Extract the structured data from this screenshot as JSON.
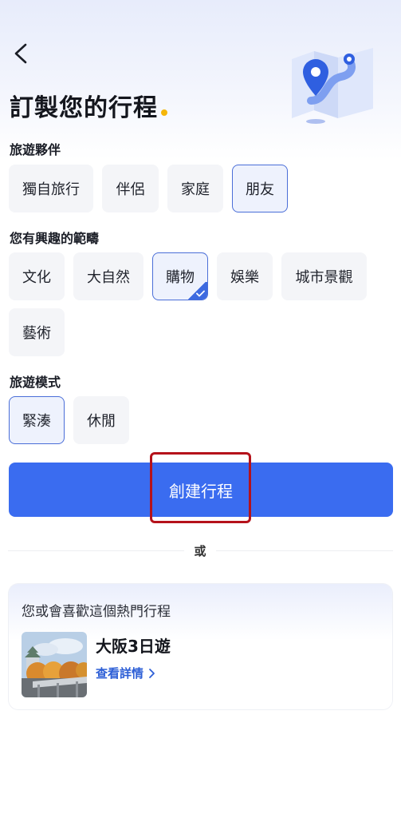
{
  "header": {
    "title": "訂製您的行程"
  },
  "companions": {
    "label": "旅遊夥伴",
    "options": [
      "獨自旅行",
      "伴侶",
      "家庭",
      "朋友"
    ],
    "selected": "朋友"
  },
  "interests": {
    "label": "您有興趣的範疇",
    "options": [
      "文化",
      "大自然",
      "購物",
      "娛樂",
      "城市景觀",
      "藝術"
    ],
    "selected": [
      "購物"
    ]
  },
  "mode": {
    "label": "旅遊模式",
    "options": [
      "緊湊",
      "休閒"
    ],
    "selected": "緊湊"
  },
  "cta": {
    "label": "創建行程"
  },
  "divider": {
    "or_label": "或"
  },
  "recommendation": {
    "heading": "您或會喜歡這個熱門行程",
    "trip_name": "大阪3日遊",
    "link_label": "查看詳情"
  },
  "colors": {
    "primary": "#3a6cf0",
    "accent_dot": "#f5b60a",
    "highlight_box": "#b5121b"
  }
}
